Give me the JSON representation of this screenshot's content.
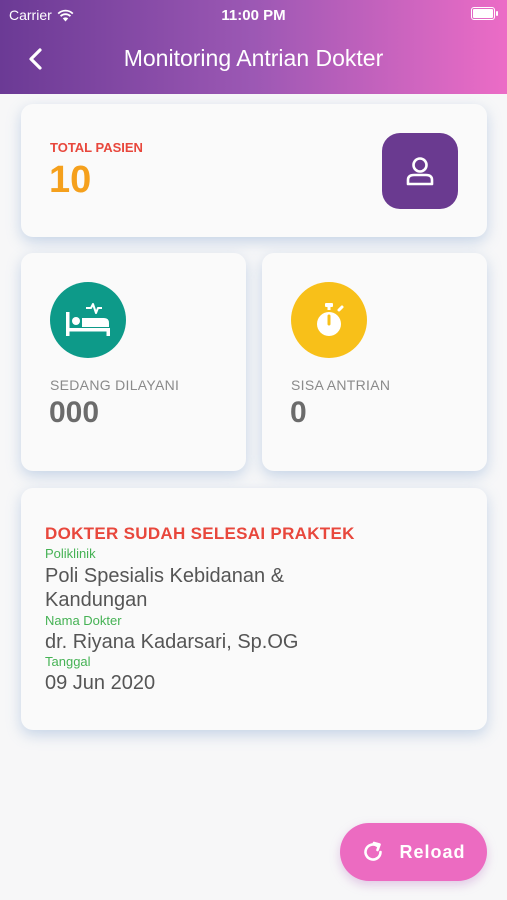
{
  "status_bar": {
    "carrier": "Carrier",
    "time": "11:00 PM"
  },
  "header": {
    "title": "Monitoring Antrian Dokter",
    "back_icon": "chevron-left-icon"
  },
  "summary": {
    "label": "TOTAL PASIEN",
    "value": "10",
    "icon": "user-icon"
  },
  "serving": {
    "label": "SEDANG DILAYANI",
    "value": "000",
    "icon": "hospital-bed-icon"
  },
  "remaining": {
    "label": "SISA ANTRIAN",
    "value": "0",
    "icon": "stopwatch-icon"
  },
  "info": {
    "status": "DOKTER SUDAH SELESAI PRAKTEK",
    "poliklinik_label": "Poliklinik",
    "poliklinik_value": "Poli Spesialis Kebidanan & Kandungan",
    "doctor_label": "Nama Dokter",
    "doctor_value": "dr. Riyana Kadarsari, Sp.OG",
    "date_label": "Tanggal",
    "date_value": "09 Jun 2020"
  },
  "reload": {
    "label": "Reload",
    "icon": "refresh-icon"
  },
  "colors": {
    "header_start": "#6b3a95",
    "header_end": "#ec6cc6",
    "accent_red": "#e8473c",
    "total_orange": "#f5a01c",
    "teal": "#0d9a89",
    "yellow": "#f8c019",
    "label_green": "#45b254",
    "reload_pink": "#ec6bc1"
  }
}
